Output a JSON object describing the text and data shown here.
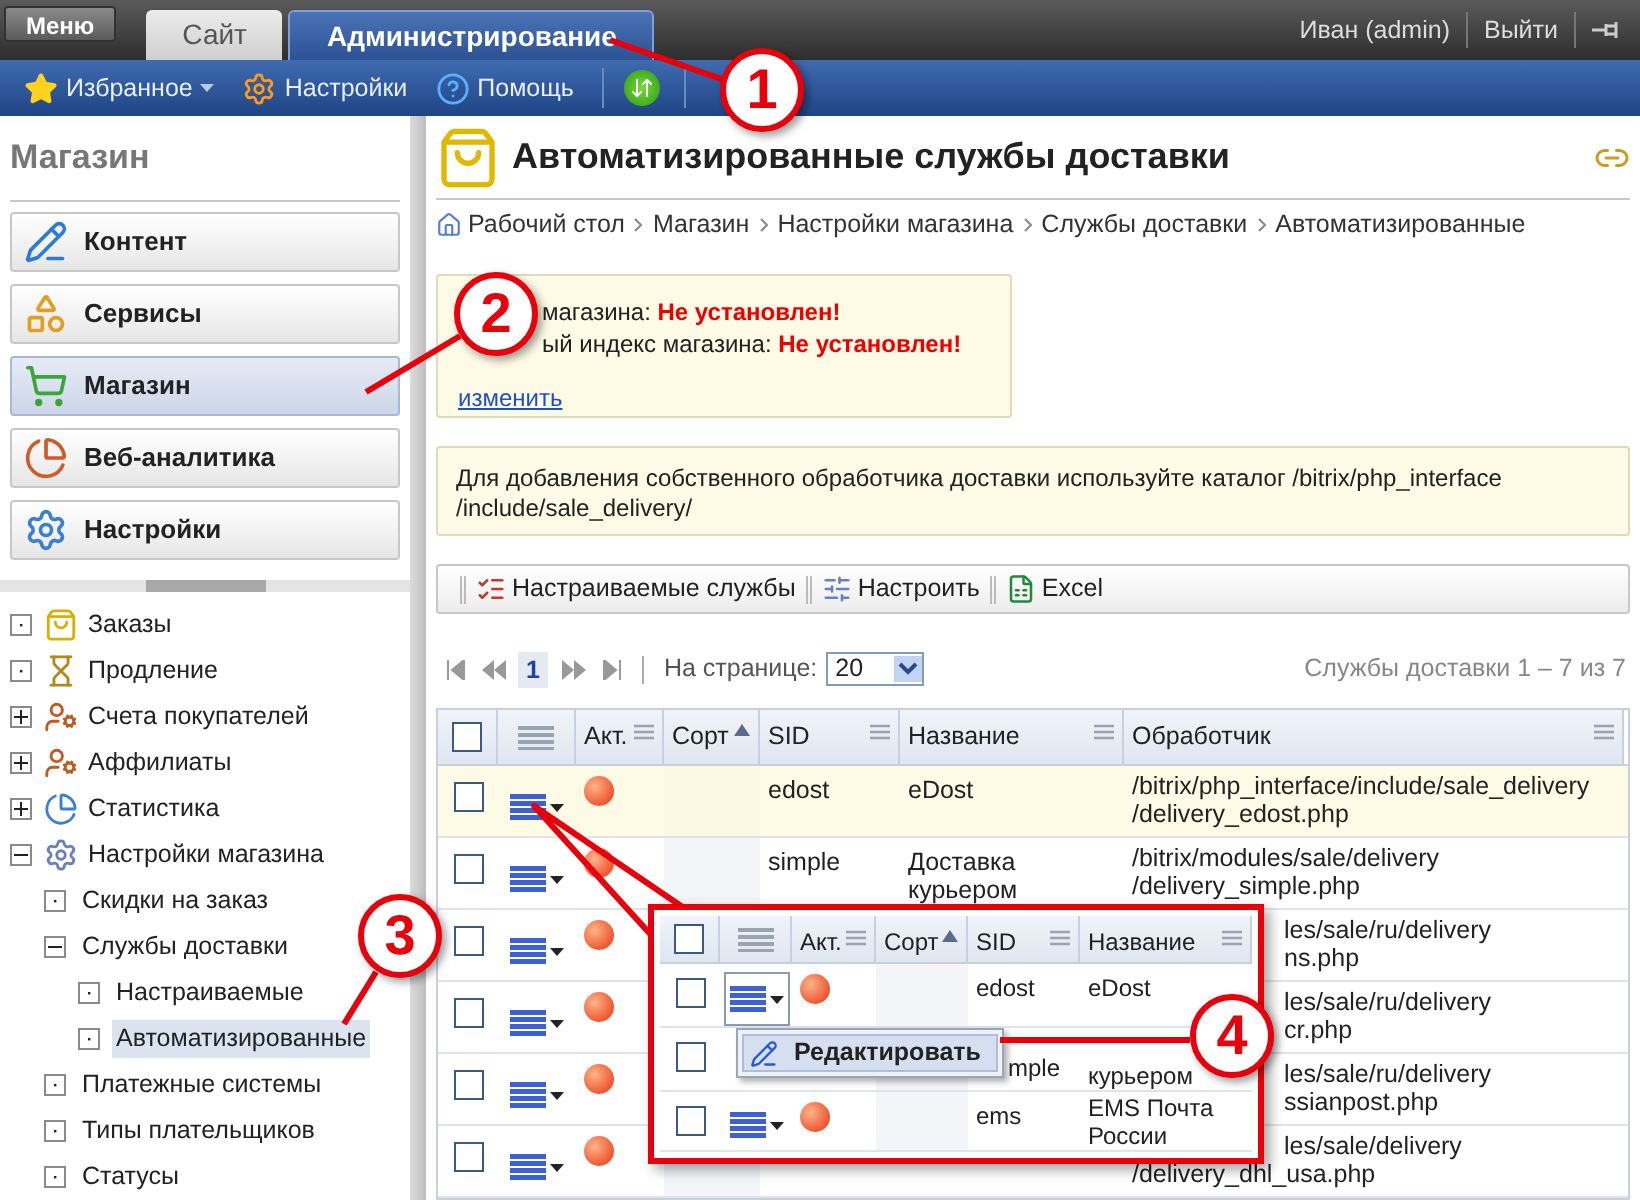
{
  "menu_button": "Меню",
  "tabs": [
    {
      "label": "Сайт",
      "selected": false
    },
    {
      "label": "Администрирование",
      "selected": true
    }
  ],
  "user": {
    "name": "Иван (admin)",
    "logout": "Выйти"
  },
  "toolbar": [
    {
      "label": "Избранное",
      "kind": "favorites",
      "dropdown": true
    },
    {
      "label": "Настройки",
      "kind": "settings",
      "dropdown": false
    },
    {
      "label": "Помощь",
      "kind": "help",
      "dropdown": false
    }
  ],
  "sidebar": {
    "title": "Магазин",
    "buttons": [
      {
        "label": "Контент",
        "kind": "content",
        "selected": false
      },
      {
        "label": "Сервисы",
        "kind": "services",
        "selected": false
      },
      {
        "label": "Магазин",
        "kind": "shop",
        "selected": true
      },
      {
        "label": "Веб-аналитика",
        "kind": "analytics",
        "selected": false
      },
      {
        "label": "Настройки",
        "kind": "settings",
        "selected": false
      }
    ]
  },
  "tree": [
    {
      "label": "Заказы",
      "kind": "leaf",
      "selected": false
    },
    {
      "label": "Продление",
      "kind": "leaf",
      "selected": false
    },
    {
      "label": "Счета покупателей",
      "kind": "folder",
      "expanded": false,
      "selected": false
    },
    {
      "label": "Аффилиаты",
      "kind": "folder",
      "expanded": false,
      "selected": false
    },
    {
      "label": "Статистика",
      "kind": "folder",
      "expanded": false,
      "selected": false
    },
    {
      "label": "Настройки магазина",
      "kind": "folder",
      "expanded": true,
      "selected": false,
      "children": [
        {
          "label": "Скидки на заказ",
          "kind": "leaf",
          "selected": false
        },
        {
          "label": "Службы доставки",
          "kind": "folder",
          "expanded": true,
          "selected": false,
          "children": [
            {
              "label": "Настраиваемые",
              "kind": "leaf",
              "selected": false
            },
            {
              "label": "Автоматизированные",
              "kind": "leaf",
              "selected": true
            }
          ]
        },
        {
          "label": "Платежные системы",
          "kind": "leaf",
          "selected": false
        },
        {
          "label": "Типы плательщиков",
          "kind": "leaf",
          "selected": false
        },
        {
          "label": "Статусы",
          "kind": "leaf",
          "selected": false
        }
      ]
    }
  ],
  "page": {
    "title": "Автоматизированные службы доставки",
    "breadcrumbs": [
      "Рабочий стол",
      "Магазин",
      "Настройки магазина",
      "Службы доставки",
      "Автоматизированные"
    ]
  },
  "info": {
    "lines": [
      "магазина: **Не установлен!**",
      "ый индекс магазина: **Не установлен!**"
    ],
    "link": "изменить"
  },
  "note": {
    "lines": [
      "Для добавления собственного обработчика доставки используйте каталог /bitrix/php_interface",
      "/include/sale_delivery/"
    ]
  },
  "actions": [
    {
      "label": "Настраиваемые службы",
      "kind": "list"
    },
    {
      "label": "Настроить",
      "kind": "settings"
    },
    {
      "label": "Excel",
      "kind": "excel"
    }
  ],
  "pager": {
    "pages": [
      {
        "label": "1",
        "selected": true
      }
    ],
    "per_page_label": "На странице:",
    "per_page": "20",
    "summary": "Службы доставки 1 – 7 из 7"
  },
  "table": {
    "columns": [
      {
        "kind": "check",
        "checked": false
      },
      {
        "kind": "actions"
      },
      {
        "kind": "text",
        "label": "Акт.",
        "sorted": false
      },
      {
        "kind": "text",
        "label": "Сорт",
        "sorted": true
      },
      {
        "kind": "text",
        "label": "SID",
        "sorted": false
      },
      {
        "kind": "text",
        "label": "Название",
        "sorted": false
      },
      {
        "kind": "text",
        "label": "Обработчик",
        "sorted": false
      }
    ],
    "rows": [
      {
        "checked": false,
        "active": false,
        "highlighted": true,
        "sid": "edost",
        "name": "eDost",
        "handler": [
          {
            "text": "/bitrix/php_interface/include/sale_delivery",
            "kind": "full"
          },
          {
            "text": "/delivery_edost.php",
            "kind": "full"
          }
        ]
      },
      {
        "checked": false,
        "active": false,
        "highlighted": false,
        "sid": "simple",
        "name": "Доставка курьером",
        "handler": [
          {
            "text": "/bitrix/modules/sale/delivery",
            "kind": "full"
          },
          {
            "text": "/delivery_simple.php",
            "kind": "full"
          }
        ]
      },
      {
        "checked": false,
        "active": false,
        "highlighted": false,
        "handler": [
          {
            "text": "les/sale/ru/delivery",
            "kind": "partial"
          },
          {
            "text": "ns.php",
            "kind": "partial"
          }
        ]
      },
      {
        "checked": false,
        "active": false,
        "highlighted": false,
        "handler": [
          {
            "text": "les/sale/ru/delivery",
            "kind": "partial"
          },
          {
            "text": "cr.php",
            "kind": "partial"
          }
        ]
      },
      {
        "checked": false,
        "active": false,
        "highlighted": false,
        "handler": [
          {
            "text": "les/sale/ru/delivery",
            "kind": "partial"
          },
          {
            "text": "ssianpost.php",
            "kind": "partial"
          }
        ]
      },
      {
        "checked": false,
        "active": false,
        "highlighted": false,
        "handler": [
          {
            "text": "les/sale/delivery",
            "kind": "partial"
          },
          {
            "text": "/delivery_dhl_usa.php",
            "kind": "full"
          }
        ]
      }
    ]
  },
  "inset": {
    "columns": [
      {
        "kind": "check",
        "checked": false
      },
      {
        "kind": "actions"
      },
      {
        "kind": "text",
        "label": "Акт.",
        "sorted": false
      },
      {
        "kind": "text",
        "label": "Сорт",
        "sorted": true
      },
      {
        "kind": "text",
        "label": "SID",
        "sorted": false
      },
      {
        "kind": "text",
        "label": "Название",
        "sorted": false
      }
    ],
    "rows": [
      {
        "kind": "full",
        "checked": false,
        "active": false,
        "menu_open": true,
        "sid": "edost",
        "name": "eDost"
      },
      {
        "kind": "covered",
        "checked": false,
        "sid": "mple",
        "name": "курьером"
      },
      {
        "kind": "full",
        "checked": false,
        "active": false,
        "menu_open": false,
        "sid": "ems",
        "name": "EMS Почта России"
      }
    ],
    "menu": [
      {
        "label": "Редактировать"
      }
    ]
  },
  "callouts": [
    "1",
    "2",
    "3",
    "4"
  ]
}
